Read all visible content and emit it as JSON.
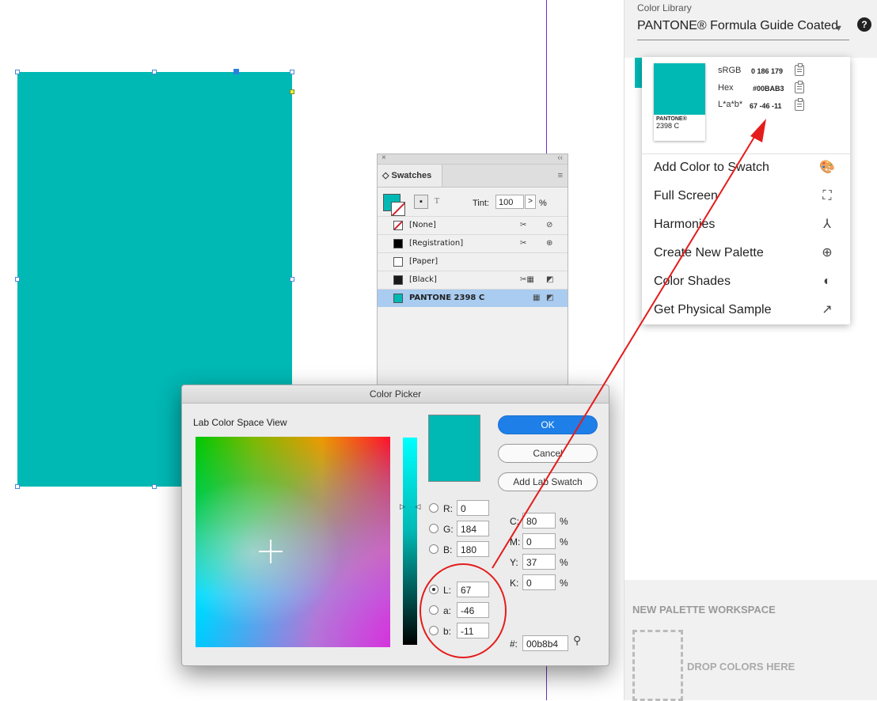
{
  "swatches_panel": {
    "close": "×",
    "collapse": "‹‹",
    "tab": "◇ Swatches",
    "menu": "≡",
    "tint_label": "Tint:",
    "tint_value": "100",
    "tint_step": ">",
    "tint_unit": "%",
    "text_mode": "T",
    "rows": [
      {
        "name": "[None]",
        "chip": "#ffffff"
      },
      {
        "name": "[Registration]",
        "chip": "#000000"
      },
      {
        "name": "[Paper]",
        "chip": "#ffffff"
      },
      {
        "name": "[Black]",
        "chip": "#1a1a1a"
      },
      {
        "name": "PANTONE 2398 C",
        "chip": "#00b8b4"
      }
    ]
  },
  "color_picker": {
    "title": "Color Picker",
    "view_label": "Lab Color Space View",
    "ok": "OK",
    "cancel": "Cancel",
    "add_swatch": "Add Lab Swatch",
    "rgb": {
      "R": "0",
      "G": "184",
      "B": "180"
    },
    "lab": {
      "L": "67",
      "a": "-46",
      "b": "-11"
    },
    "cmyk": {
      "C": "80",
      "M": "0",
      "Y": "37",
      "K": "0"
    },
    "labels": {
      "R": "R:",
      "G": "G:",
      "B": "B:",
      "L": "L:",
      "a": "a:",
      "b": "b:",
      "C": "C:",
      "M": "M:",
      "Y": "Y:",
      "K": "K:"
    },
    "pct": "%",
    "hex_label": "#:",
    "hex": "00b8b4",
    "color": "#00b8b4"
  },
  "color_library": {
    "title": "Color Library",
    "selected": "PANTONE® Formula Guide Coated",
    "help": "?",
    "chip_brand": "PANTONE®",
    "chip_code": "2398 C",
    "info": [
      {
        "label": "sRGB",
        "value": "0 186 179"
      },
      {
        "label": "Hex",
        "value": "#00BAB3"
      },
      {
        "label": "L*a*b*",
        "value": "67 -46 -11"
      }
    ],
    "menu": [
      {
        "label": "Add Color to Swatch",
        "icon": "palette-icon"
      },
      {
        "label": "Full Screen",
        "icon": "fullscreen-icon"
      },
      {
        "label": "Harmonies",
        "icon": "harmonies-icon"
      },
      {
        "label": "Create New Palette",
        "icon": "plus-circle-icon"
      },
      {
        "label": "Color Shades",
        "icon": "shades-icon"
      },
      {
        "label": "Get Physical Sample",
        "icon": "external-link-icon"
      }
    ],
    "workspace_label": "NEW PALETTE WORKSPACE",
    "drop_label": "DROP COLORS HERE"
  },
  "annotation_color": "#e41c1c"
}
